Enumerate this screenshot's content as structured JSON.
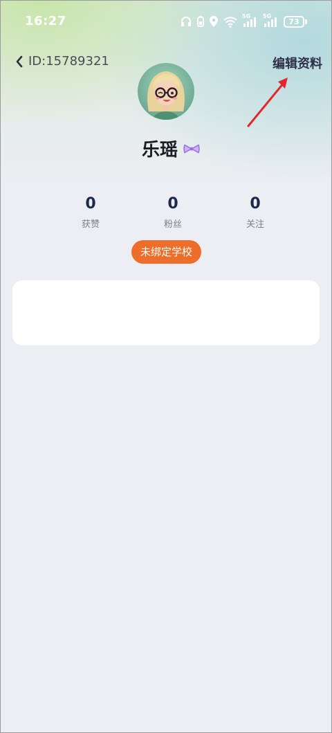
{
  "status_bar": {
    "time": "16:27",
    "battery": "73",
    "network_1": "5G",
    "network_2": "5G"
  },
  "header": {
    "id_label": "ID:15789321",
    "edit_label": "编辑资料"
  },
  "profile": {
    "name": "乐瑶"
  },
  "stats": [
    {
      "value": "0",
      "label": "获赞"
    },
    {
      "value": "0",
      "label": "粉丝"
    },
    {
      "value": "0",
      "label": "关注"
    }
  ],
  "school_button": "未绑定学校",
  "colors": {
    "accent": "#ec6e2a",
    "arrow": "#e0282c",
    "badge": "#9b6fe0"
  }
}
